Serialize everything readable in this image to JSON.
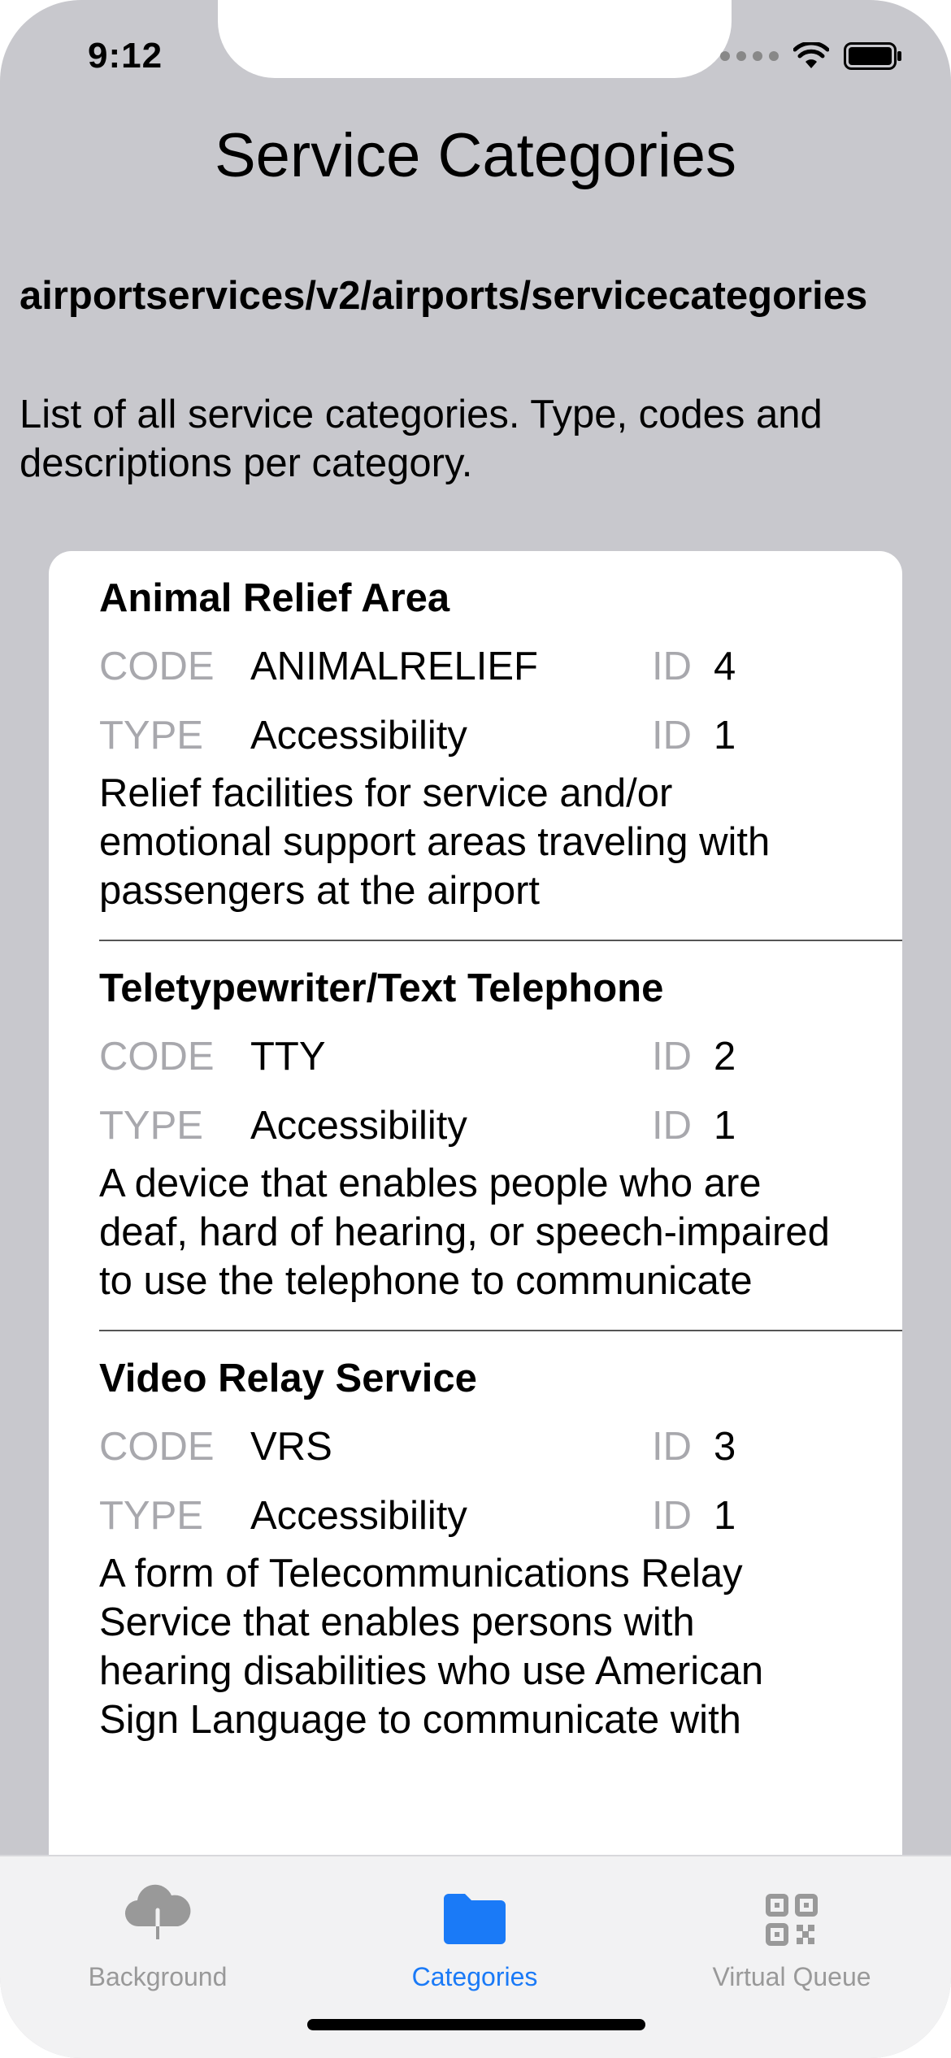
{
  "status_bar": {
    "time": "9:12"
  },
  "page": {
    "title": "Service Categories",
    "endpoint": "airportservices/v2/airports/servicecategories",
    "description": "List of all service categories. Type, codes and descriptions per category."
  },
  "labels": {
    "code": "CODE",
    "type": "TYPE",
    "id": "ID"
  },
  "categories": [
    {
      "name": "Animal Relief Area",
      "code": "ANIMALRELIEF",
      "code_id": "4",
      "type": "Accessibility",
      "type_id": "1",
      "description": "Relief facilities for service and/or emotional support areas traveling with passengers at the airport"
    },
    {
      "name": "Teletypewriter/Text Telephone",
      "code": "TTY",
      "code_id": "2",
      "type": "Accessibility",
      "type_id": "1",
      "description": "A device that enables people who are deaf, hard of hearing, or speech-impaired to use the telephone to communicate"
    },
    {
      "name": "Video Relay Service",
      "code": "VRS",
      "code_id": "3",
      "type": "Accessibility",
      "type_id": "1",
      "description": "A form of Telecommunications Relay Service that enables persons with hearing disabilities who use American Sign Language to communicate with"
    }
  ],
  "tabbar": {
    "tabs": [
      {
        "label": "Background",
        "icon": "cloud-download-icon"
      },
      {
        "label": "Categories",
        "icon": "folder-icon"
      },
      {
        "label": "Virtual Queue",
        "icon": "qr-code-icon"
      }
    ],
    "active_color": "#1a7af7",
    "inactive_color": "#999999"
  }
}
